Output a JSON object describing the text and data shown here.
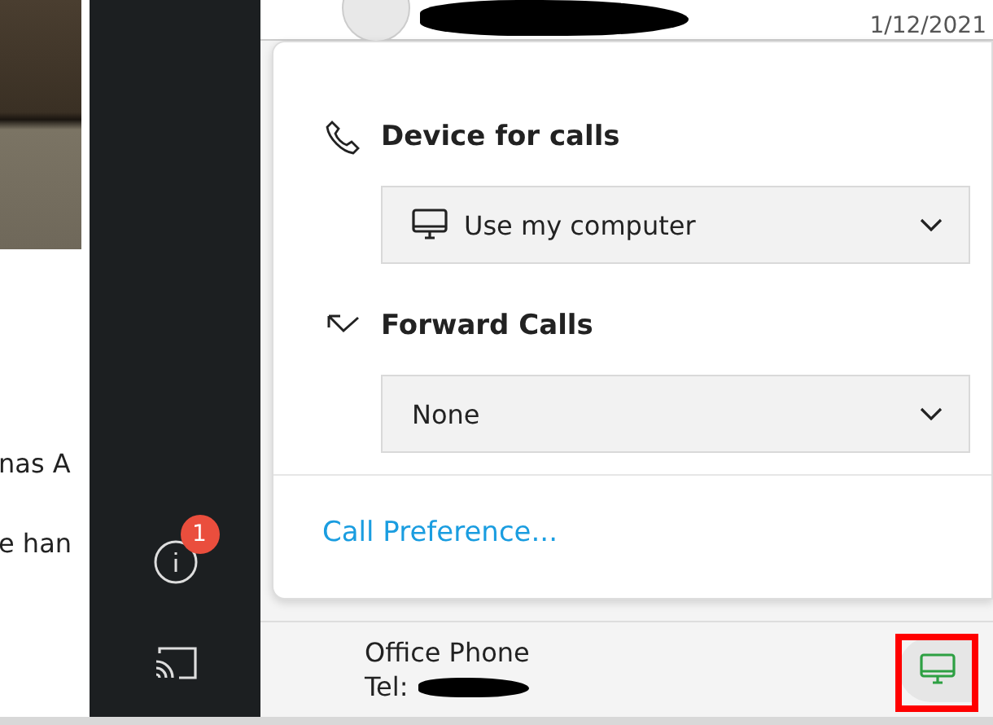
{
  "left_pane": {
    "lines": [
      "nas A",
      "e han"
    ]
  },
  "sidebar": {
    "badge": "1"
  },
  "conversation": {
    "date": "1/12/2021"
  },
  "popup": {
    "sections": [
      {
        "kind": "device",
        "title": "Device for calls",
        "value": "Use my computer"
      },
      {
        "kind": "forward",
        "title": "Forward Calls",
        "value": "None"
      }
    ],
    "link": "Call Preference..."
  },
  "footer": {
    "label": "Office Phone",
    "tel_label": "Tel:"
  }
}
